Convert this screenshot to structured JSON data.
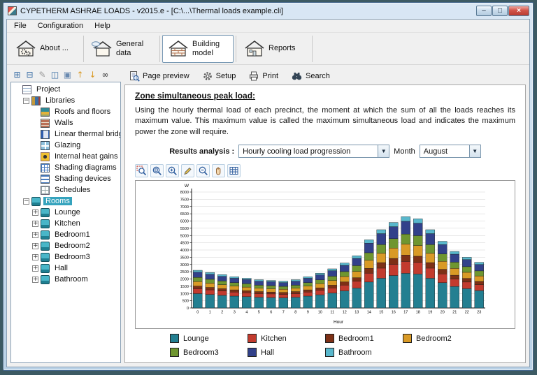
{
  "window": {
    "title": "CYPETHERM ASHRAE LOADS - v2015.e - [C:\\...\\Thermal loads example.cli]",
    "controls": [
      {
        "name": "minimize-button",
        "glyph": "–"
      },
      {
        "name": "maximize-button",
        "glyph": "□"
      },
      {
        "name": "close-button",
        "glyph": "×"
      }
    ]
  },
  "menu": {
    "items": [
      "File",
      "Configuration",
      "Help"
    ]
  },
  "main_toolbar": {
    "buttons": [
      {
        "label": "About ...",
        "active": false
      },
      {
        "label": "General data",
        "active": false
      },
      {
        "label": "Building model",
        "active": true
      },
      {
        "label": "Reports",
        "active": false
      }
    ]
  },
  "tree_toolbar": {
    "icons": [
      {
        "name": "add-branch-icon",
        "glyph": "⊞",
        "color": "#3a6ea5"
      },
      {
        "name": "remove-branch-icon",
        "glyph": "⊟",
        "color": "#3a6ea5"
      },
      {
        "name": "edit-icon",
        "glyph": "✎",
        "color": "#9a9a9a"
      },
      {
        "name": "copy-icon",
        "glyph": "◫",
        "color": "#3a6ea5"
      },
      {
        "name": "paste-icon",
        "glyph": "▣",
        "color": "#6a8ab0"
      },
      {
        "name": "move-up-icon",
        "glyph": "↑",
        "color": "#d99a26"
      },
      {
        "name": "move-down-icon",
        "glyph": "↓",
        "color": "#d99a26"
      },
      {
        "name": "find-icon",
        "glyph": "∞",
        "color": "#333333"
      }
    ]
  },
  "tree": {
    "items": [
      {
        "label": "Project",
        "icon": "project",
        "level": 0
      },
      {
        "label": "Libraries",
        "icon": "libraries",
        "level": 1,
        "expander": "minus"
      },
      {
        "label": "Roofs and floors",
        "icon": "roofs",
        "level": 2
      },
      {
        "label": "Walls",
        "icon": "walls",
        "level": 2
      },
      {
        "label": "Linear thermal bridges",
        "icon": "bridges",
        "level": 2
      },
      {
        "label": "Glazing",
        "icon": "glazing",
        "level": 2
      },
      {
        "label": "Internal heat gains",
        "icon": "heatgains",
        "level": 2
      },
      {
        "label": "Shading diagrams",
        "icon": "shading-diagrams",
        "level": 2
      },
      {
        "label": "Shading devices",
        "icon": "shading-devices",
        "level": 2
      },
      {
        "label": "Schedules",
        "icon": "schedules",
        "level": 2
      },
      {
        "label": "Rooms",
        "icon": "rooms",
        "level": 1,
        "expander": "minus",
        "selected": true
      },
      {
        "label": "Lounge",
        "icon": "room",
        "level": 2,
        "expander": "plus"
      },
      {
        "label": "Kitchen",
        "icon": "room",
        "level": 2,
        "expander": "plus"
      },
      {
        "label": "Bedroom1",
        "icon": "room",
        "level": 2,
        "expander": "plus"
      },
      {
        "label": "Bedroom2",
        "icon": "room",
        "level": 2,
        "expander": "plus"
      },
      {
        "label": "Bedroom3",
        "icon": "room",
        "level": 2,
        "expander": "plus"
      },
      {
        "label": "Hall",
        "icon": "room",
        "level": 2,
        "expander": "plus"
      },
      {
        "label": "Bathroom",
        "icon": "room",
        "level": 2,
        "expander": "plus"
      }
    ]
  },
  "report": {
    "toolbar": [
      {
        "label": "Page preview"
      },
      {
        "label": "Setup"
      },
      {
        "label": "Print"
      },
      {
        "label": "Search"
      }
    ],
    "heading": "Zone simultaneous peak load:",
    "body": "Using the hourly thermal load of each precinct, the moment at which the sum of all the loads reaches its maximum value. This maximum value is called the maximum simultaneous load and indicates the maximum power the zone will require."
  },
  "controls": {
    "results_label": "Results analysis :",
    "results_value": "Hourly cooling load progression",
    "month_label": "Month",
    "month_value": "August"
  },
  "chart_data": {
    "type": "bar",
    "stacked": true,
    "xlabel": "Hour",
    "ylabel": "W",
    "ylim": [
      0,
      8000
    ],
    "ytick_step": 500,
    "grid": "horizontal",
    "legend_position": "bottom",
    "x": [
      0,
      1,
      2,
      3,
      4,
      5,
      6,
      7,
      8,
      9,
      10,
      11,
      12,
      13,
      14,
      15,
      16,
      17,
      18,
      19,
      20,
      21,
      22,
      23
    ],
    "series": [
      {
        "name": "Lounge",
        "color": "#237f91",
        "values": [
          990,
          930,
          870,
          820,
          780,
          740,
          720,
          700,
          740,
          820,
          910,
          1030,
          1180,
          1370,
          1790,
          2050,
          2240,
          2390,
          2340,
          2050,
          1750,
          1480,
          1330,
          1200
        ]
      },
      {
        "name": "Kitchen",
        "color": "#c23b2e",
        "values": [
          340,
          320,
          300,
          280,
          270,
          250,
          250,
          240,
          250,
          280,
          310,
          350,
          400,
          470,
          610,
          700,
          770,
          820,
          800,
          700,
          600,
          510,
          460,
          410
        ]
      },
      {
        "name": "Bedroom1",
        "color": "#7d3016",
        "values": [
          180,
          170,
          160,
          150,
          140,
          140,
          130,
          130,
          140,
          150,
          170,
          190,
          220,
          250,
          330,
          380,
          410,
          440,
          430,
          380,
          320,
          270,
          250,
          220
        ]
      },
      {
        "name": "Bedroom2",
        "color": "#d99a26",
        "values": [
          310,
          290,
          280,
          260,
          250,
          230,
          230,
          220,
          230,
          260,
          290,
          320,
          370,
          430,
          560,
          650,
          710,
          760,
          740,
          650,
          550,
          470,
          420,
          380
        ]
      },
      {
        "name": "Bedroom3",
        "color": "#6f9630",
        "values": [
          290,
          270,
          250,
          240,
          230,
          210,
          210,
          200,
          210,
          240,
          260,
          300,
          340,
          400,
          520,
          590,
          650,
          690,
          680,
          590,
          510,
          430,
          390,
          350
        ]
      },
      {
        "name": "Hall",
        "color": "#32418a",
        "values": [
          360,
          340,
          320,
          300,
          290,
          270,
          270,
          260,
          270,
          300,
          340,
          380,
          430,
          500,
          660,
          760,
          830,
          880,
          860,
          760,
          640,
          550,
          490,
          440
        ]
      },
      {
        "name": "Bathroom",
        "color": "#58b7cc",
        "values": [
          130,
          130,
          120,
          100,
          90,
          110,
          90,
          100,
          110,
          100,
          120,
          130,
          160,
          180,
          230,
          270,
          290,
          320,
          300,
          270,
          230,
          190,
          160,
          150
        ]
      }
    ]
  }
}
